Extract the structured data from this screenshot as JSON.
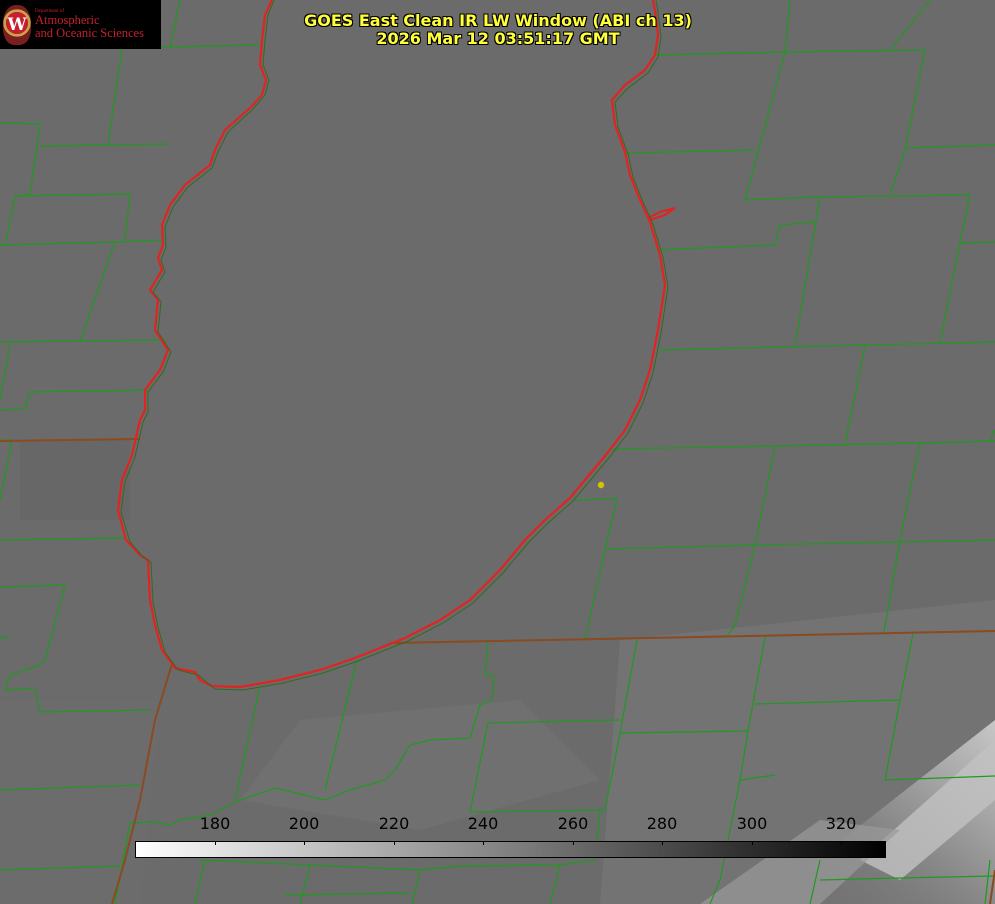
{
  "logo": {
    "department": "Department of",
    "line1": "Atmospheric",
    "line2": "and Oceanic Sciences",
    "seal_letter": "W"
  },
  "title": {
    "line1": "GOES East Clean IR LW Window (ABI ch 13)",
    "line2": "2026 Mar 12 03:51:17 GMT"
  },
  "colorbar": {
    "ticks": [
      "180",
      "200",
      "220",
      "240",
      "260",
      "280",
      "300",
      "320"
    ],
    "gradient": "white (cold) to black (warm)"
  },
  "colors": {
    "county_lines": "#1f9a1f",
    "state_and_coast_lines": "#e32222",
    "title_text": "#ffff3c",
    "marker": "#d6c000",
    "logo_red": "#c5202e"
  }
}
